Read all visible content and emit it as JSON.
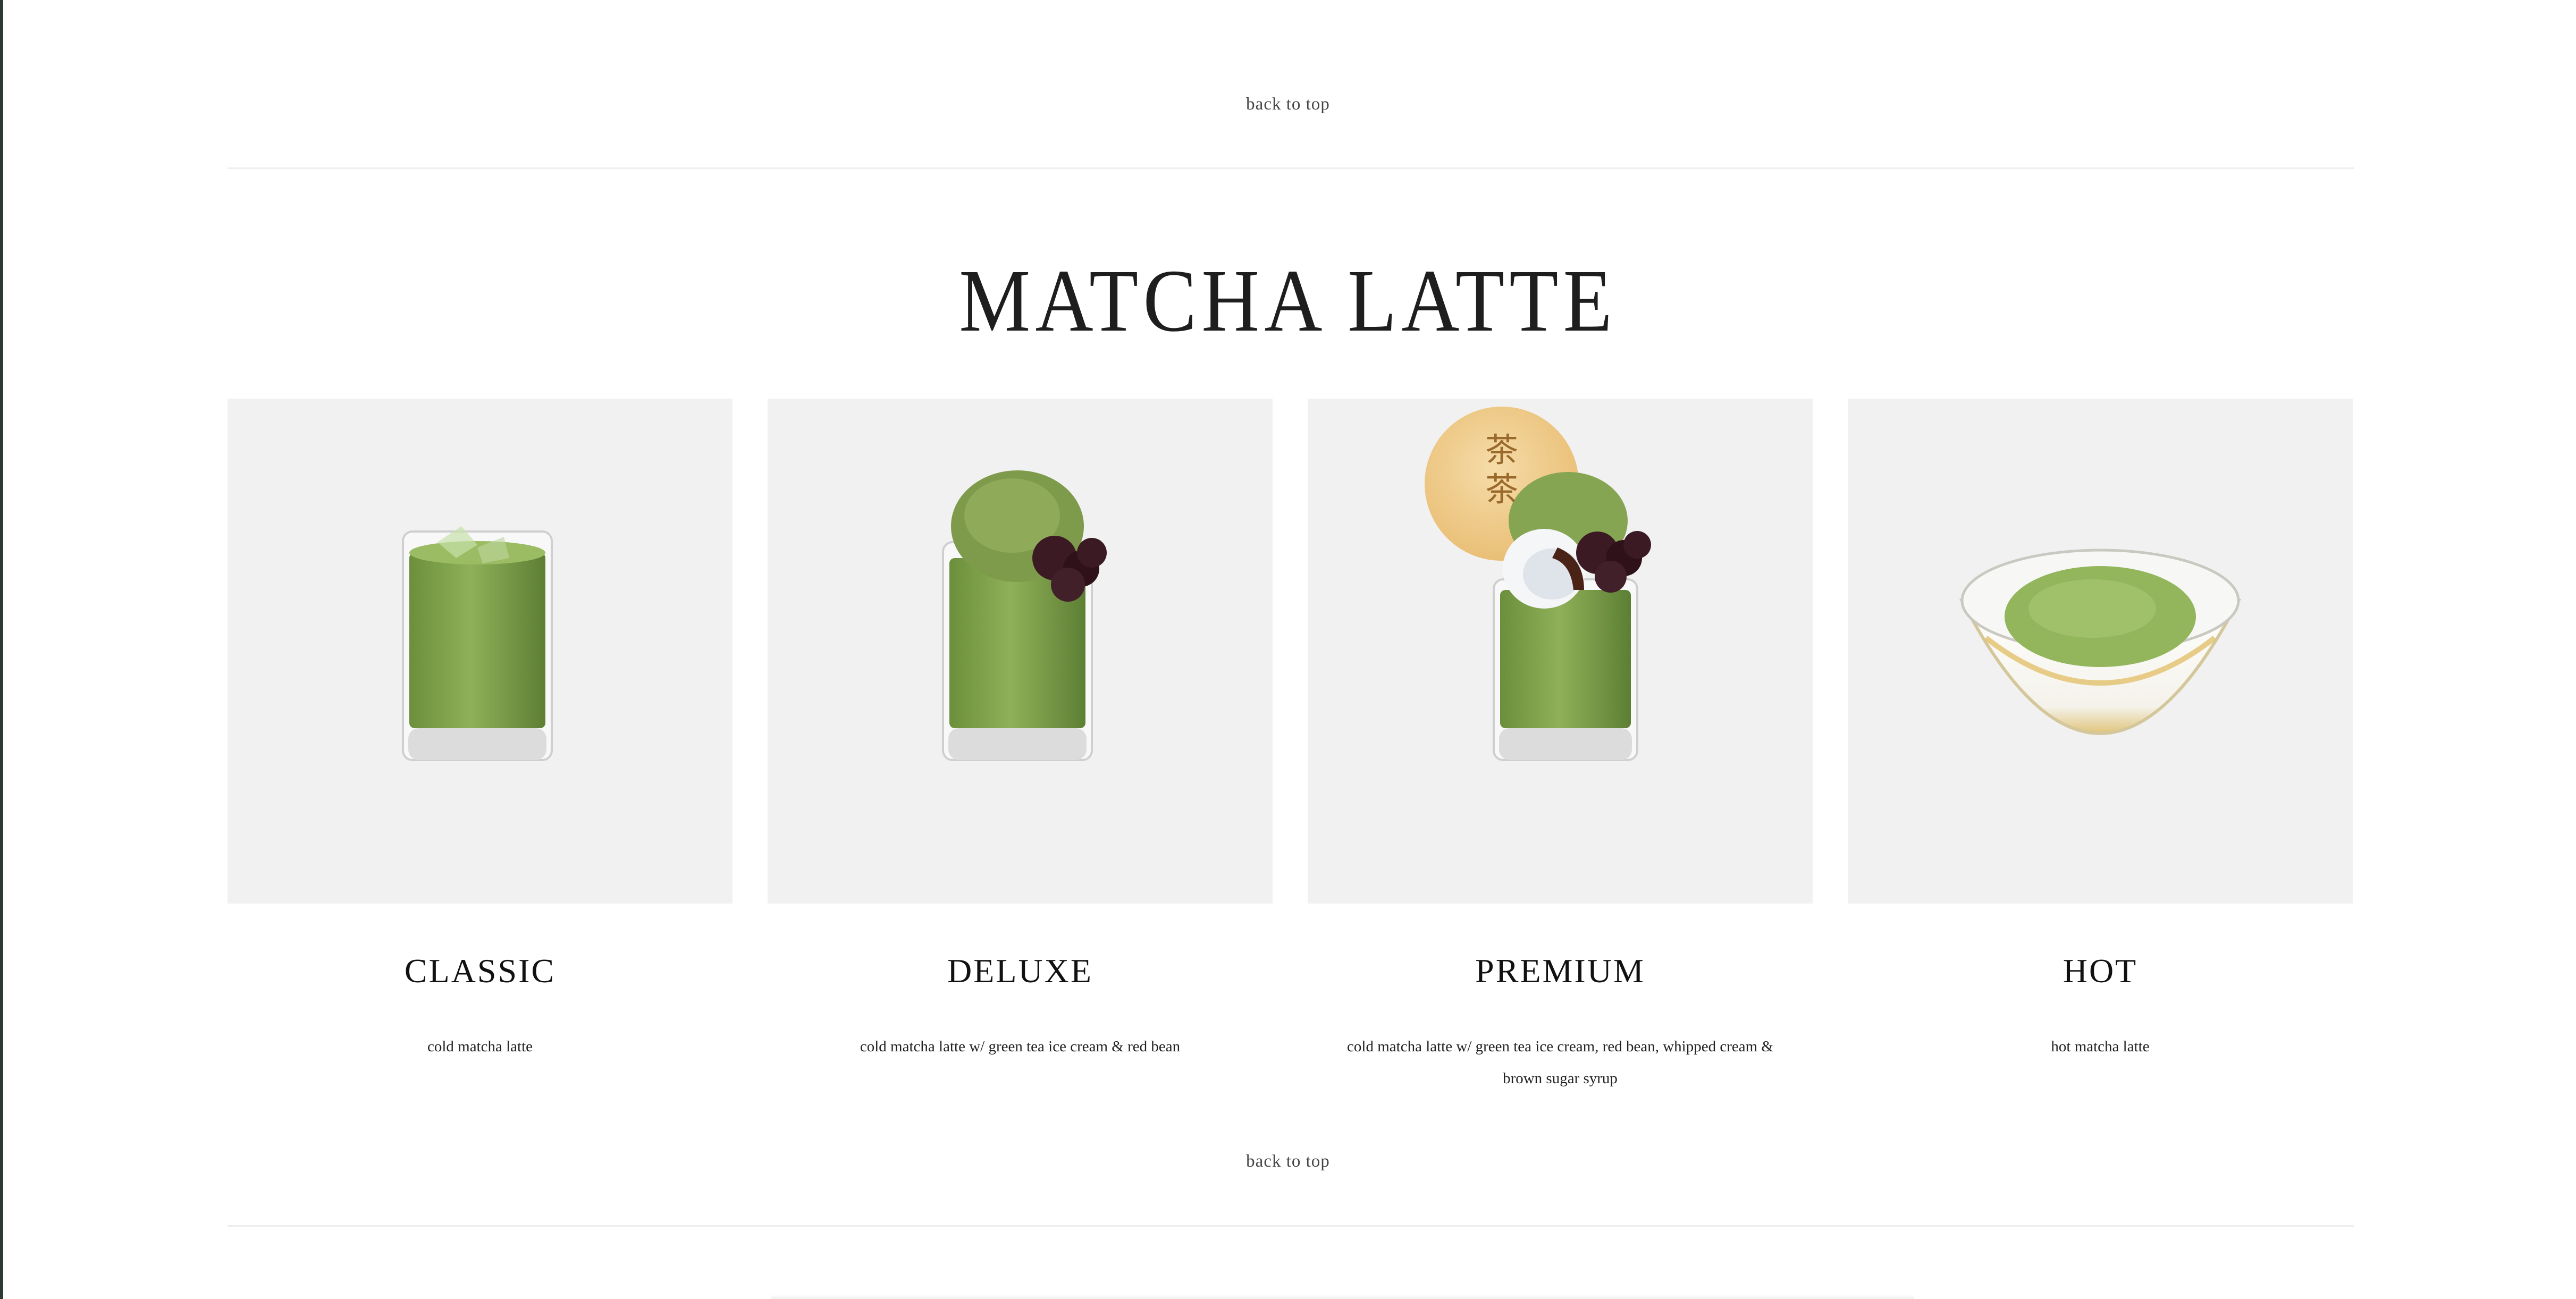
{
  "nav": {
    "back_to_top": "back to top"
  },
  "section": {
    "title": "MATCHA LATTE"
  },
  "products": [
    {
      "name": "CLASSIC",
      "description": "cold matcha latte",
      "image": "iced-matcha-latte-glass-icon"
    },
    {
      "name": "DELUXE",
      "description": "cold matcha latte w/ green tea ice cream & red bean",
      "image": "matcha-latte-with-ice-cream-icon"
    },
    {
      "name": "PREMIUM",
      "description": "cold matcha latte w/ green tea ice cream, red bean, whipped cream & brown sugar syrup",
      "image": "matcha-latte-with-cookie-icon",
      "cookie_text": "茶茶"
    },
    {
      "name": "HOT",
      "description": "hot matcha latte",
      "image": "hot-matcha-bowl-icon"
    }
  ],
  "colors": {
    "matcha": "#7a9d47",
    "matcha_dark": "#5d7f34",
    "red_bean": "#3b1a24",
    "card_bg": "#f1f1f1",
    "divider": "#eeeeee"
  }
}
